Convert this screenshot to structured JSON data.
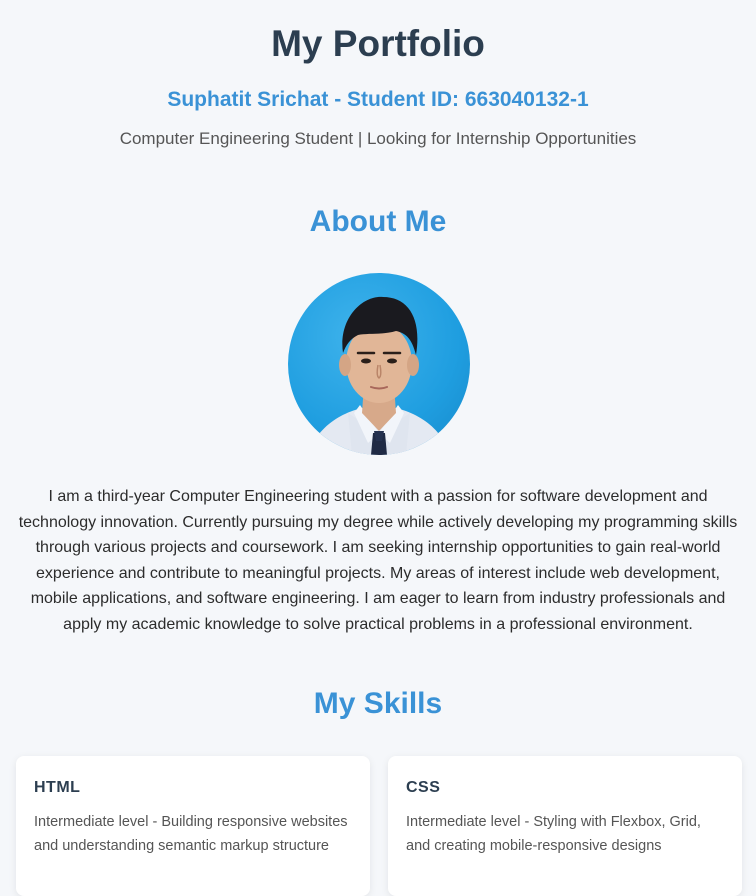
{
  "header": {
    "title": "My Portfolio",
    "subtitle": "Suphatit Srichat - Student ID: 663040132-1",
    "tagline": "Computer Engineering Student | Looking for Internship Opportunities"
  },
  "about": {
    "heading": "About Me",
    "photo_icon": "profile-photo",
    "text": "I am a third-year Computer Engineering student with a passion for software development and technology innovation. Currently pursuing my degree while actively developing my programming skills through various projects and coursework. I am seeking internship opportunities to gain real-world experience and contribute to meaningful projects. My areas of interest include web development, mobile applications, and software engineering. I am eager to learn from industry professionals and apply my academic knowledge to solve practical problems in a professional environment."
  },
  "skills": {
    "heading": "My Skills",
    "items": [
      {
        "name": "HTML",
        "description": "Intermediate level - Building responsive websites and understanding semantic markup structure"
      },
      {
        "name": "CSS",
        "description": "Intermediate level - Styling with Flexbox, Grid, and creating mobile-responsive designs"
      }
    ]
  },
  "colors": {
    "background": "#f5f7fa",
    "heading_dark": "#2c3e50",
    "accent_blue": "#3a92d6",
    "card_bg": "#ffffff"
  }
}
